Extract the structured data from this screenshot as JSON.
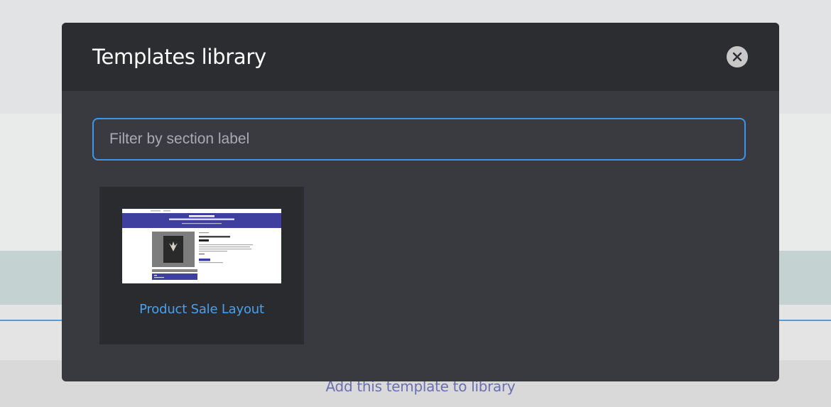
{
  "modal": {
    "title": "Templates library",
    "close_icon": "close-icon"
  },
  "filter": {
    "placeholder": "Filter by section label",
    "value": ""
  },
  "templates": [
    {
      "label": "Product Sale Layout",
      "thumbnail_icon": "template-preview-image"
    }
  ],
  "background": {
    "add_template_link": "Add this template to library"
  },
  "colors": {
    "accent_blue": "#3d95e8",
    "modal_bg": "#393a40",
    "header_bg": "#2c2d31",
    "card_bg": "#2a2b2f",
    "link_purple": "#6c6fb1",
    "thumb_banner": "#3f3fa0"
  }
}
